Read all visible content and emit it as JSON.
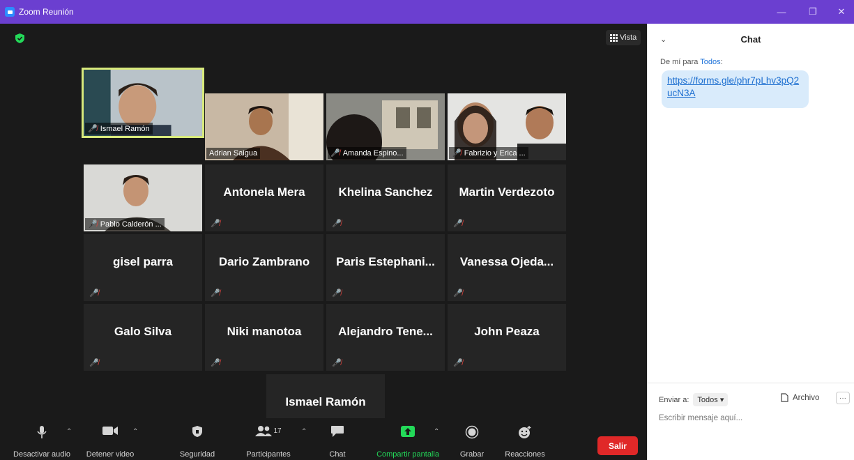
{
  "window": {
    "title": "Zoom Reunión"
  },
  "view_button": {
    "label": "Vista"
  },
  "tiles": [
    {
      "name": "Ismael Ramón",
      "video": true,
      "active": true
    },
    {
      "name": "Adrian Saigua",
      "video": true,
      "muted": false
    },
    {
      "name": "Amanda Espino...",
      "video": true
    },
    {
      "name": "Fabrizio y Erica ...",
      "video": true
    },
    {
      "name": "Pablo Calderón ...",
      "video": true
    },
    {
      "name": "Antonela Mera"
    },
    {
      "name": "Khelina Sanchez"
    },
    {
      "name": "Martin Verdezoto"
    },
    {
      "name": "gisel parra"
    },
    {
      "name": "Dario Zambrano"
    },
    {
      "name": "Paris  Estephani..."
    },
    {
      "name": "Vanessa  Ojeda..."
    },
    {
      "name": "Galo Silva"
    },
    {
      "name": "Niki manotoa"
    },
    {
      "name": "Alejandro  Tene..."
    },
    {
      "name": "John Peaza"
    },
    {
      "name": "Ismael Ramón"
    }
  ],
  "toolbar": {
    "mute": "Desactivar audio",
    "video": "Detener video",
    "security": "Seguridad",
    "participants": "Participantes",
    "participants_count": "17",
    "chat": "Chat",
    "share": "Compartir pantalla",
    "record": "Grabar",
    "reactions": "Reacciones",
    "leave": "Salir"
  },
  "chat": {
    "title": "Chat",
    "from_prefix": "De mí para",
    "from_to": "Todos",
    "message_link": "https://forms.gle/phr7pLhv3pQ2ucN3A",
    "send_to_label": "Enviar a:",
    "send_to_value": "Todos",
    "file_label": "Archivo",
    "input_placeholder": "Escribir mensaje aquí..."
  },
  "colors": {
    "titlebar": "#6b3fd0",
    "accent_green": "#23d959",
    "leave_red": "#e02828",
    "link_blue": "#1d6fd0"
  }
}
